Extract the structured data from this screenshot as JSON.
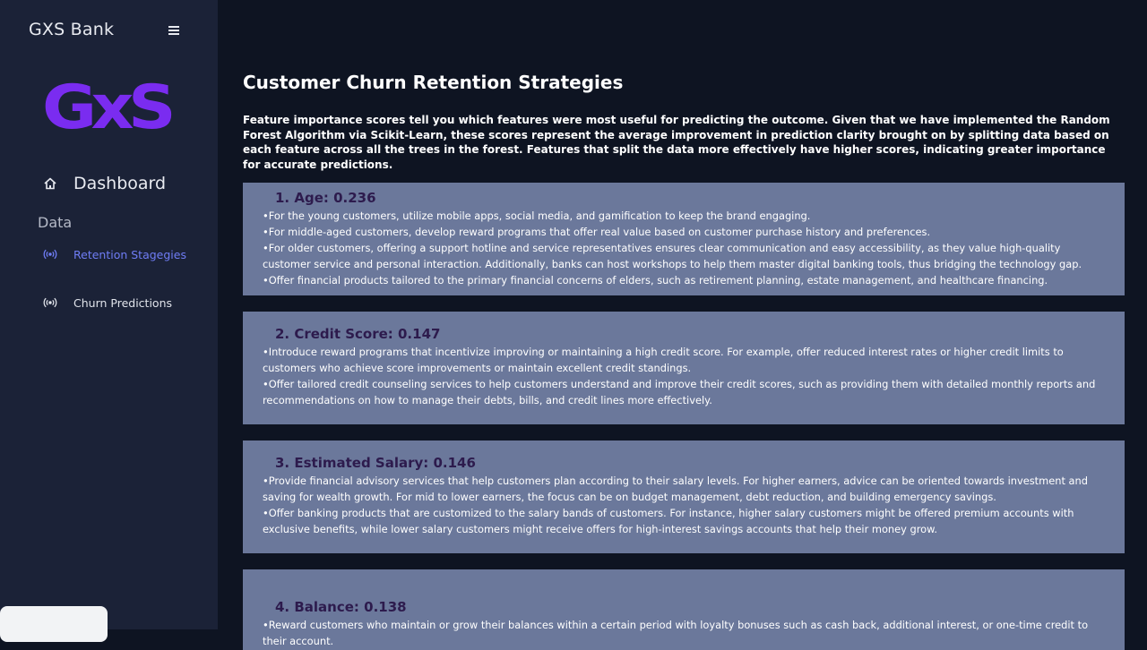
{
  "app": {
    "brand": "GXS Bank",
    "logo_text": "GxS"
  },
  "sidebar": {
    "menu_icon": "hamburger-icon",
    "dashboard_label": "Dashboard",
    "section_label": "Data",
    "items": [
      {
        "label": "Retention Stagegies",
        "icon": "broadcast-icon",
        "active": true
      },
      {
        "label": "Churn Predictions",
        "icon": "broadcast-icon",
        "active": false
      }
    ]
  },
  "header": {
    "theme_icon": "moon-icon"
  },
  "page": {
    "title": "Customer Churn Retention Strategies",
    "intro": "Feature importance scores tell you which features were most useful for predicting the outcome. Given that we have implemented the Random Forest Algorithm via Scikit-Learn, these scores represent the average improvement in prediction clarity brought on by splitting data based on each feature across all the trees in the forest. Features that split the data more effectively have higher scores, indicating greater importance for accurate predictions."
  },
  "cards": [
    {
      "title": "1. Age: 0.236",
      "items": [
        "For the young customers, utilize mobile apps, social media, and gamification to keep the brand engaging.",
        "For middle-aged customers, develop reward programs that offer real value based on customer purchase history and preferences.",
        "For older customers, offering a support hotline and service representatives ensures clear communication and easy accessibility, as they value high-quality customer service and personal interaction. Additionally, banks can host workshops to help them master digital banking tools, thus bridging the technology gap.",
        "Offer financial products tailored to the primary financial concerns of elders, such as retirement planning, estate management, and healthcare financing."
      ]
    },
    {
      "title": "2. Credit Score: 0.147",
      "items": [
        "Introduce reward programs that incentivize improving or maintaining a high credit score. For example, offer reduced interest rates or higher credit limits to customers who achieve score improvements or maintain excellent credit standings.",
        "Offer tailored credit counseling services to help customers understand and improve their credit scores, such as providing them with detailed monthly reports and recommendations on how to manage their debts, bills, and credit lines more effectively."
      ]
    },
    {
      "title": "3. Estimated Salary: 0.146",
      "items": [
        "Provide financial advisory services that help customers plan according to their salary levels. For higher earners, advice can be oriented towards investment and saving for wealth growth. For mid to lower earners, the focus can be on budget management, debt reduction, and building emergency savings.",
        "Offer banking products that are customized to the salary bands of customers. For instance, higher salary customers might be offered premium accounts with exclusive benefits, while lower salary customers might receive offers for high-interest savings accounts that help their money grow."
      ]
    },
    {
      "title": "4. Balance: 0.138",
      "items": [
        "Reward customers who maintain or grow their balances within a certain period with loyalty bonuses such as cash back, additional interest, or one-time credit to their account."
      ]
    }
  ]
}
